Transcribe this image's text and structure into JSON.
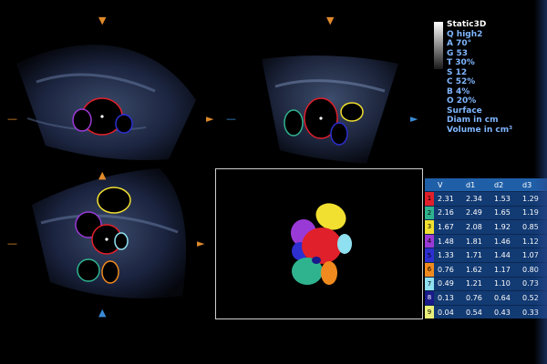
{
  "params": {
    "mode": "Static3D",
    "q": "Q high2",
    "a": "A 70°",
    "g": "G 53",
    "t": "T 30%",
    "s": "S 12",
    "c": "C 52%",
    "b": "B 4%",
    "o": "O 20%",
    "render": "Surface",
    "diam_unit": "Diam in cm",
    "volume_unit": "Volume in cm³"
  },
  "table": {
    "headers": [
      "",
      "V",
      "d1",
      "d2",
      "d3"
    ],
    "rows": [
      {
        "idx": "1",
        "color": "#e0202a",
        "v": "2.31",
        "d1": "2.34",
        "d2": "1.53",
        "d3": "1.29"
      },
      {
        "idx": "2",
        "color": "#2fb38f",
        "v": "2.16",
        "d1": "2.49",
        "d2": "1.65",
        "d3": "1.19"
      },
      {
        "idx": "3",
        "color": "#f2e030",
        "v": "1.67",
        "d1": "2.08",
        "d2": "1.92",
        "d3": "0.85"
      },
      {
        "idx": "4",
        "color": "#9a3ad6",
        "v": "1.48",
        "d1": "1.81",
        "d2": "1.46",
        "d3": "1.12"
      },
      {
        "idx": "5",
        "color": "#2d2fd0",
        "v": "1.33",
        "d1": "1.71",
        "d2": "1.44",
        "d3": "1.07"
      },
      {
        "idx": "6",
        "color": "#f08a1e",
        "v": "0.76",
        "d1": "1.62",
        "d2": "1.17",
        "d3": "0.80"
      },
      {
        "idx": "7",
        "color": "#8fe0f0",
        "v": "0.49",
        "d1": "1.21",
        "d2": "1.10",
        "d3": "0.73"
      },
      {
        "idx": "8",
        "color": "#1a1a8a",
        "v": "0.13",
        "d1": "0.76",
        "d2": "0.64",
        "d3": "0.52"
      },
      {
        "idx": "9",
        "color": "#e8f07a",
        "v": "0.04",
        "d1": "0.54",
        "d2": "0.43",
        "d3": "0.33"
      }
    ]
  }
}
